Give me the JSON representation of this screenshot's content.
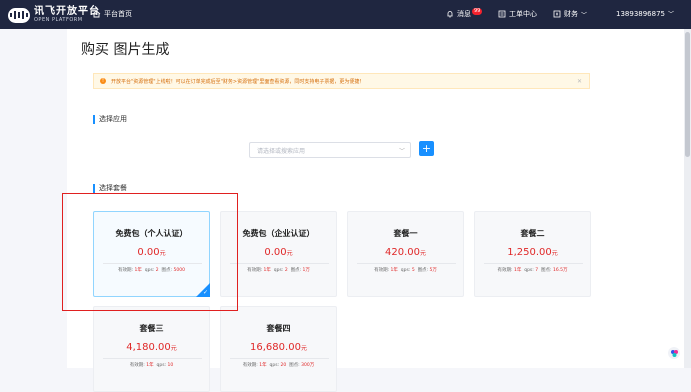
{
  "header": {
    "logo_title": "讯飞开放平台",
    "logo_subtitle": "OPEN PLATFORM",
    "home_label": "平台首页",
    "messages_label": "消息",
    "messages_badge": "99",
    "tickets_label": "工单中心",
    "finance_label": "财务",
    "user_phone": "13893896875"
  },
  "page": {
    "title": "购买 图片生成"
  },
  "notice": {
    "text": "开放平台\"资源管理\"上线啦！可以在订单完成后至\"财务>资源管理\"里面查看资源，同时支持电子票据，更为便捷！"
  },
  "app_section": {
    "label": "选择应用",
    "select_placeholder": "请选择或搜索应用",
    "add_button": "+"
  },
  "package_section": {
    "label": "选择套餐",
    "specs_labels": {
      "validity": "有效期:",
      "qps": "qps:",
      "points": "图点:"
    },
    "packages": [
      {
        "name": "免费包（个人认证）",
        "price": "0.00",
        "unit": "元",
        "validity": "1年",
        "qps": "2",
        "points": "5000",
        "selected": true
      },
      {
        "name": "免费包（企业认证）",
        "price": "0.00",
        "unit": "元",
        "validity": "1年",
        "qps": "2",
        "points": "1万",
        "selected": false
      },
      {
        "name": "套餐一",
        "price": "420.00",
        "unit": "元",
        "validity": "1年",
        "qps": "5",
        "points": "5万",
        "selected": false
      },
      {
        "name": "套餐二",
        "price": "1,250.00",
        "unit": "元",
        "validity": "1年",
        "qps": "7",
        "points": "16.5万",
        "selected": false
      },
      {
        "name": "套餐三",
        "price": "4,180.00",
        "unit": "元",
        "validity": "1年",
        "qps": "10",
        "points": "",
        "selected": false
      },
      {
        "name": "套餐四",
        "price": "16,680.00",
        "unit": "元",
        "validity": "1年",
        "qps": "20",
        "points": "300万",
        "selected": false
      }
    ]
  },
  "colors": {
    "accent": "#1890ff",
    "price": "#e02828",
    "topbar": "#1f2640",
    "highlight_box": "#e02020"
  }
}
